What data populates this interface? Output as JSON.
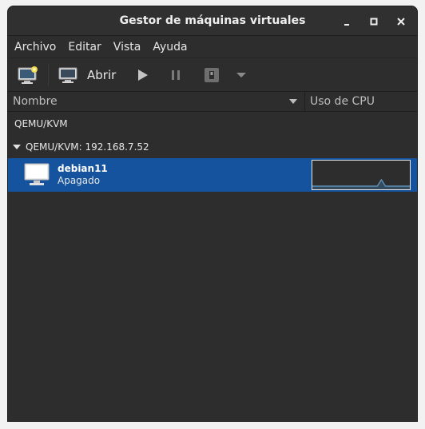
{
  "window": {
    "title": "Gestor de máquinas virtuales"
  },
  "menu": {
    "items": [
      "Archivo",
      "Editar",
      "Vista",
      "Ayuda"
    ]
  },
  "toolbar": {
    "open_label": "Abrir"
  },
  "columns": {
    "name": "Nombre",
    "cpu": "Uso de CPU"
  },
  "connections": [
    {
      "label": "QEMU/KVM"
    },
    {
      "label": "QEMU/KVM: 192.168.7.52",
      "expanded": true
    }
  ],
  "vm": {
    "name": "debian11",
    "status": "Apagado",
    "cpu_history": [
      0,
      0,
      0,
      0,
      0,
      0,
      0,
      0,
      0,
      0,
      0,
      0,
      0,
      0,
      0,
      0,
      0,
      1,
      0,
      0,
      0,
      0,
      0,
      0,
      0
    ]
  },
  "colors": {
    "selection": "#15539e",
    "window_bg": "#2d2d2d",
    "graph_line": "#5d8fb4"
  }
}
